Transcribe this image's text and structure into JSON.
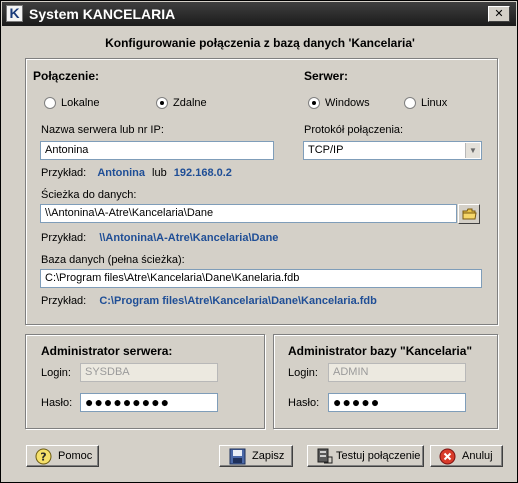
{
  "window": {
    "title": "System KANCELARIA",
    "close_symbol": "✕"
  },
  "header": "Konfigurowanie połączenia z bazą danych 'Kancelaria'",
  "connection": {
    "label": "Połączenie:",
    "options": [
      "Lokalne",
      "Zdalne"
    ],
    "selected": "Zdalne"
  },
  "server": {
    "label": "Serwer:",
    "options": [
      "Windows",
      "Linux"
    ],
    "selected": "Windows"
  },
  "server_name": {
    "label": "Nazwa serwera lub nr IP:",
    "value": "Antonina",
    "example_prefix": "Przykład:",
    "example_name": "Antonina",
    "example_or": "lub",
    "example_ip": "192.168.0.2"
  },
  "protocol": {
    "label": "Protokół połączenia:",
    "value": "TCP/IP"
  },
  "data_path": {
    "label": "Ścieżka do danych:",
    "value": "\\\\Antonina\\A-Atre\\Kancelaria\\Dane",
    "example_prefix": "Przykład:",
    "example": "\\\\Antonina\\A-Atre\\Kancelaria\\Dane"
  },
  "database": {
    "label": "Baza danych (pełna ścieżka):",
    "value": "C:\\Program files\\Atre\\Kancelaria\\Dane\\Kanelaria.fdb",
    "example_prefix": "Przykład:",
    "example": "C:\\Program files\\Atre\\Kancelaria\\Dane\\Kancelaria.fdb"
  },
  "server_admin": {
    "title": "Administrator serwera:",
    "login_label": "Login:",
    "login_value": "SYSDBA",
    "password_label": "Hasło:",
    "password_mask": "●●●●●●●●●"
  },
  "db_admin": {
    "title": "Administrator bazy \"Kancelaria\"",
    "login_label": "Login:",
    "login_value": "ADMIN",
    "password_label": "Hasło:",
    "password_mask": "●●●●●"
  },
  "buttons": {
    "help": "Pomoc",
    "save": "Zapisz",
    "test": "Testuj połączenie",
    "cancel": "Anuluj"
  },
  "colors": {
    "link": "#1f4e96",
    "titlebar": "#2b2b2b",
    "face": "#d4d0c8"
  }
}
